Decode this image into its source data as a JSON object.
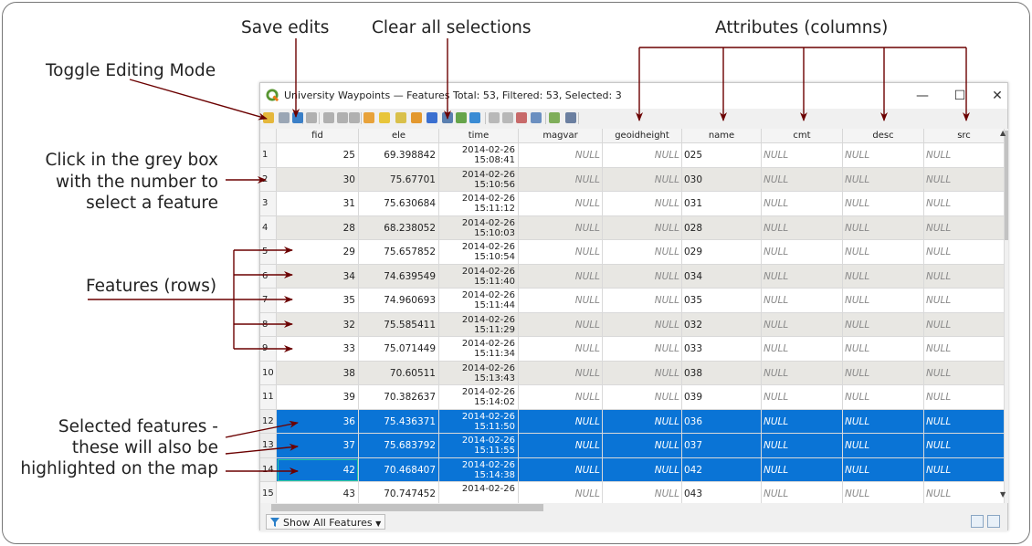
{
  "annotations": {
    "save_edits": "Save edits",
    "clear_selections": "Clear all selections",
    "attributes": "Attributes (columns)",
    "toggle_editing": "Toggle Editing Mode",
    "click_grey_box": [
      "Click in the grey box",
      "with the number to",
      "select a feature"
    ],
    "features_rows": "Features (rows)",
    "selected_features": [
      "Selected features -",
      "these will also be",
      "highlighted on the map"
    ]
  },
  "window": {
    "title": "University Waypoints — Features Total: 53, Filtered: 53, Selected: 3",
    "minimize": "—",
    "maximize": "☐",
    "close": "✕"
  },
  "toolbar": {
    "icons": [
      "toggle-editing-icon",
      "save-edits-icon",
      "reload-icon",
      "delete-feature-icon",
      "cut-icon",
      "copy-icon",
      "paste-icon",
      "select-by-expression-icon",
      "select-all-icon",
      "invert-selection-icon",
      "deselect-all-icon",
      "filter-selected-icon",
      "move-to-top-icon",
      "pan-to-selected-icon",
      "zoom-to-selected-icon",
      "new-field-icon",
      "delete-field-icon",
      "field-calculator-icon",
      "conditional-formatting-icon",
      "dock-icon",
      "actions-icon"
    ]
  },
  "columns": [
    "fid",
    "ele",
    "time",
    "magvar",
    "geoidheight",
    "name",
    "cmt",
    "desc",
    "src"
  ],
  "rows": [
    {
      "n": "1",
      "fid": "25",
      "ele": "69.398842",
      "date": "2014-02-26",
      "clock": "15:08:41",
      "magvar": "NULL",
      "geoidheight": "NULL",
      "name": "025",
      "cmt": "NULL",
      "desc": "NULL",
      "src": "NULL",
      "state": "normal"
    },
    {
      "n": "2",
      "fid": "30",
      "ele": "75.67701",
      "date": "2014-02-26",
      "clock": "15:10:56",
      "magvar": "NULL",
      "geoidheight": "NULL",
      "name": "030",
      "cmt": "NULL",
      "desc": "NULL",
      "src": "NULL",
      "state": "alt"
    },
    {
      "n": "3",
      "fid": "31",
      "ele": "75.630684",
      "date": "2014-02-26",
      "clock": "15:11:12",
      "magvar": "NULL",
      "geoidheight": "NULL",
      "name": "031",
      "cmt": "NULL",
      "desc": "NULL",
      "src": "NULL",
      "state": "normal"
    },
    {
      "n": "4",
      "fid": "28",
      "ele": "68.238052",
      "date": "2014-02-26",
      "clock": "15:10:03",
      "magvar": "NULL",
      "geoidheight": "NULL",
      "name": "028",
      "cmt": "NULL",
      "desc": "NULL",
      "src": "NULL",
      "state": "alt"
    },
    {
      "n": "5",
      "fid": "29",
      "ele": "75.657852",
      "date": "2014-02-26",
      "clock": "15:10:54",
      "magvar": "NULL",
      "geoidheight": "NULL",
      "name": "029",
      "cmt": "NULL",
      "desc": "NULL",
      "src": "NULL",
      "state": "normal"
    },
    {
      "n": "6",
      "fid": "34",
      "ele": "74.639549",
      "date": "2014-02-26",
      "clock": "15:11:40",
      "magvar": "NULL",
      "geoidheight": "NULL",
      "name": "034",
      "cmt": "NULL",
      "desc": "NULL",
      "src": "NULL",
      "state": "alt"
    },
    {
      "n": "7",
      "fid": "35",
      "ele": "74.960693",
      "date": "2014-02-26",
      "clock": "15:11:44",
      "magvar": "NULL",
      "geoidheight": "NULL",
      "name": "035",
      "cmt": "NULL",
      "desc": "NULL",
      "src": "NULL",
      "state": "normal"
    },
    {
      "n": "8",
      "fid": "32",
      "ele": "75.585411",
      "date": "2014-02-26",
      "clock": "15:11:29",
      "magvar": "NULL",
      "geoidheight": "NULL",
      "name": "032",
      "cmt": "NULL",
      "desc": "NULL",
      "src": "NULL",
      "state": "alt"
    },
    {
      "n": "9",
      "fid": "33",
      "ele": "75.071449",
      "date": "2014-02-26",
      "clock": "15:11:34",
      "magvar": "NULL",
      "geoidheight": "NULL",
      "name": "033",
      "cmt": "NULL",
      "desc": "NULL",
      "src": "NULL",
      "state": "normal"
    },
    {
      "n": "10",
      "fid": "38",
      "ele": "70.60511",
      "date": "2014-02-26",
      "clock": "15:13:43",
      "magvar": "NULL",
      "geoidheight": "NULL",
      "name": "038",
      "cmt": "NULL",
      "desc": "NULL",
      "src": "NULL",
      "state": "alt"
    },
    {
      "n": "11",
      "fid": "39",
      "ele": "70.382637",
      "date": "2014-02-26",
      "clock": "15:14:02",
      "magvar": "NULL",
      "geoidheight": "NULL",
      "name": "039",
      "cmt": "NULL",
      "desc": "NULL",
      "src": "NULL",
      "state": "normal"
    },
    {
      "n": "12",
      "fid": "36",
      "ele": "75.436371",
      "date": "2014-02-26",
      "clock": "15:11:50",
      "magvar": "NULL",
      "geoidheight": "NULL",
      "name": "036",
      "cmt": "NULL",
      "desc": "NULL",
      "src": "NULL",
      "state": "sel"
    },
    {
      "n": "13",
      "fid": "37",
      "ele": "75.683792",
      "date": "2014-02-26",
      "clock": "15:11:55",
      "magvar": "NULL",
      "geoidheight": "NULL",
      "name": "037",
      "cmt": "NULL",
      "desc": "NULL",
      "src": "NULL",
      "state": "sel"
    },
    {
      "n": "14",
      "fid": "42",
      "ele": "70.468407",
      "date": "2014-02-26",
      "clock": "15:14:38",
      "magvar": "NULL",
      "geoidheight": "NULL",
      "name": "042",
      "cmt": "NULL",
      "desc": "NULL",
      "src": "NULL",
      "state": "sel focus"
    },
    {
      "n": "15",
      "fid": "43",
      "ele": "70.747452",
      "date": "2014-02-26",
      "clock": "",
      "magvar": "NULL",
      "geoidheight": "NULL",
      "name": "043",
      "cmt": "NULL",
      "desc": "NULL",
      "src": "NULL",
      "state": "normal"
    }
  ],
  "statusbar": {
    "show_all": "Show All Features"
  },
  "colors": {
    "arrow": "#6b0000",
    "selected": "#0a74d6",
    "alt_row": "#e8e7e3"
  }
}
